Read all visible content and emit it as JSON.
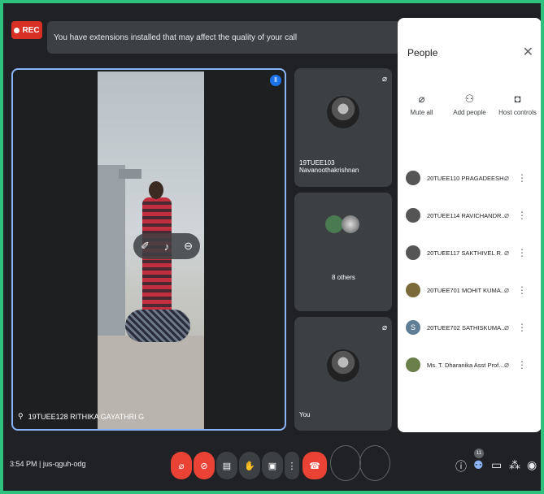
{
  "rec": {
    "label": "REC"
  },
  "banner": {
    "text": "You have extensions installed that may affect the quality of your call"
  },
  "main_tile": {
    "name": "19TUEE128 RITHIKA GAYATHRI G"
  },
  "side_tiles": [
    {
      "name": "19TUEE103 Navanoothakrishnan"
    },
    {
      "name": "8 others"
    },
    {
      "name": "You"
    }
  ],
  "people_panel": {
    "title": "People",
    "actions": [
      {
        "label": "Mute all",
        "icon": "mic-off-icon"
      },
      {
        "label": "Add people",
        "icon": "add-person-icon"
      },
      {
        "label": "Host controls",
        "icon": "lock-icon"
      }
    ],
    "participants": [
      {
        "name": "20TUEE110 PRAGADEESH...",
        "avatar": ""
      },
      {
        "name": "20TUEE114 RAVICHANDR...",
        "avatar": ""
      },
      {
        "name": "20TUEE117 SAKTHIVEL R.",
        "avatar": ""
      },
      {
        "name": "20TUEE701 MOHIT KUMA...",
        "avatar": ""
      },
      {
        "name": "20TUEE702 SATHISKUMA...",
        "avatar": "S"
      },
      {
        "name": "Ms. T. Dharanika Asst Prof...",
        "avatar": ""
      }
    ]
  },
  "bottom": {
    "time": "3:54 PM",
    "separator": "|",
    "meeting_code": "jus-qguh-odg",
    "participant_count": "11"
  },
  "colors": {
    "accent": "#8ab4f8",
    "end_call": "#ea4335",
    "border": "#2ec27e"
  }
}
